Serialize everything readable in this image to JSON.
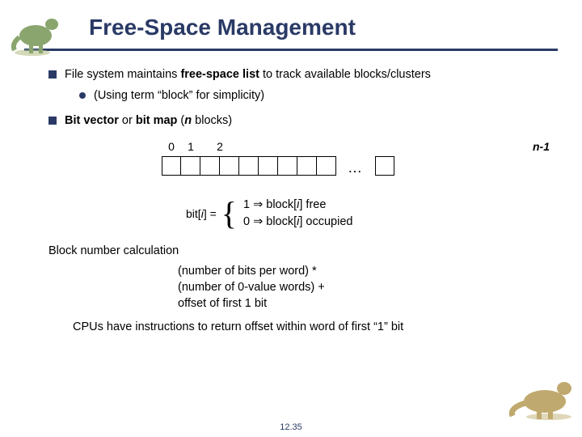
{
  "slide": {
    "title": "Free-Space Management",
    "bullets": [
      {
        "text_pre": "File system maintains ",
        "term": "free-space list",
        "text_post": " to track available blocks/clusters",
        "sub": [
          {
            "pre": "(Using term ",
            "q1": "“",
            "word": "block",
            "q2": "”",
            "post": " for simplicity)"
          }
        ]
      },
      {
        "rich": "bitvec",
        "bv_pre": "",
        "bv_bold1": "Bit vector",
        "bv_mid": " or ",
        "bv_bold2": "bit map",
        "bv_post": "  (",
        "bv_var": "n",
        "bv_post2": " blocks)"
      }
    ],
    "labels": {
      "l0": "0",
      "l1": "1",
      "l2": "2",
      "ln": "n-1",
      "ellipsis": "…"
    },
    "bitdef": {
      "eq_pre": "bit[",
      "eq_var": "i",
      "eq_post": "] =",
      "c1_pre": "1 ⇒ block[",
      "c1_var": "i",
      "c1_post": "] free",
      "c0_pre": "0 ⇒ block[",
      "c0_var": "i",
      "c0_post": "] occupied"
    },
    "calc": {
      "head": "Block number calculation",
      "l1": "(number of bits per word) *",
      "l2": "(number of 0-value words) +",
      "l3": "offset of first 1 bit"
    },
    "cpu_pre": "CPUs have instructions to return offset within word of first ",
    "cpu_q1": "“",
    "cpu_word": "1",
    "cpu_q2": "”",
    "cpu_post": " bit",
    "footer": "12.35"
  }
}
